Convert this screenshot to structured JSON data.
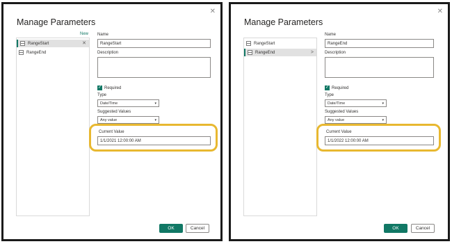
{
  "colors": {
    "accent": "#117865",
    "highlight": "#e8b830",
    "frame": "#1a1a1a"
  },
  "left": {
    "title": "Manage Parameters",
    "close_glyph": "✕",
    "new_label": "New",
    "params": [
      {
        "label": "RangeStart",
        "icon": "parameter-icon",
        "trail": "✕"
      },
      {
        "label": "RangeEnd",
        "icon": "parameter-icon",
        "trail": ""
      }
    ],
    "name_label": "Name",
    "name_value": "RangeStart",
    "description_label": "Description",
    "required_label": "Required",
    "required_checked": true,
    "type_label": "Type",
    "type_value": "Date/Time",
    "suggested_label": "Suggested Values",
    "suggested_value": "Any value",
    "current_label": "Current Value",
    "current_value": "1/1/2021 12:00:00 AM",
    "ok_label": "OK",
    "cancel_label": "Cancel"
  },
  "right": {
    "title": "Manage Parameters",
    "close_glyph": "✕",
    "params": [
      {
        "label": "RangeStart",
        "icon": "parameter-icon",
        "trail": ""
      },
      {
        "label": "RangeEnd",
        "icon": "parameter-icon",
        "trail": ">"
      }
    ],
    "name_label": "Name",
    "name_value": "RangeEnd",
    "description_label": "Description",
    "required_label": "Required",
    "required_checked": true,
    "type_label": "Type",
    "type_value": "Date/Time",
    "suggested_label": "Suggested Values",
    "suggested_value": "Any value",
    "current_label": "Current Value",
    "current_value": "1/1/2022 12:00:00 AM",
    "ok_label": "OK",
    "cancel_label": "Cancel"
  }
}
